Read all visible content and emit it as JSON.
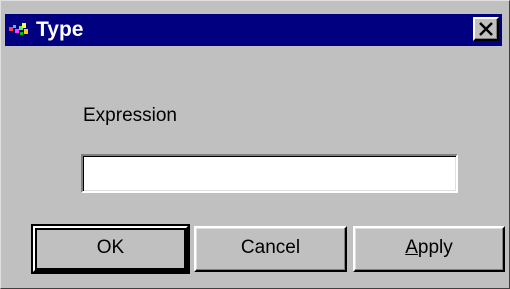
{
  "window": {
    "title": "Type",
    "icon": "app-icon",
    "close_icon": "close-icon"
  },
  "form": {
    "expression_label": "Expression",
    "expression_value": "",
    "expression_placeholder": ""
  },
  "buttons": {
    "ok": "OK",
    "cancel": "Cancel",
    "apply_first": "A",
    "apply_rest": "pply"
  },
  "colors": {
    "titlebar": "#000080",
    "face": "#c0c0c0",
    "title_text": "#ffffff"
  }
}
